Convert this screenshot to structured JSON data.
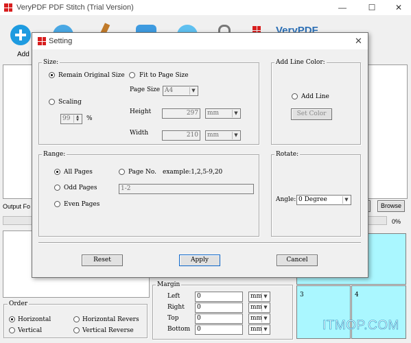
{
  "app": {
    "title": "VeryPDF PDF Stitch (Trial Version)"
  },
  "toolbar": {
    "add_label": "Add",
    "brand": "VeryPDF"
  },
  "main": {
    "output_label": "Output Fo",
    "browse_label": "Browse",
    "browse_partial": "e",
    "progress_text": "0%",
    "order": {
      "legend": "Order",
      "options": [
        "Horizontal",
        "Horizontal Revers",
        "Vertical",
        "Vertical Reverse"
      ],
      "selected": "Horizontal"
    },
    "margin": {
      "legend": "Margin",
      "rows": [
        {
          "label": "Left",
          "value": "0",
          "unit": "mm"
        },
        {
          "label": "Right",
          "value": "0",
          "unit": "mm"
        },
        {
          "label": "Top",
          "value": "0",
          "unit": "mm"
        },
        {
          "label": "Bottom",
          "value": "0",
          "unit": "mm"
        }
      ]
    },
    "preview_cells": [
      "3",
      "4"
    ]
  },
  "dialog": {
    "title": "Setting",
    "size": {
      "legend": "Size:",
      "remain_original": "Remain Original Size",
      "fit_to_page": "Fit to Page Size",
      "scaling": "Scaling",
      "scaling_value": "99",
      "percent": "%",
      "page_size_label": "Page Size",
      "page_size_value": "A4",
      "height_label": "Height",
      "height_value": "297",
      "height_unit": "mm",
      "width_label": "Width",
      "width_value": "210",
      "width_unit": "mm"
    },
    "line_color": {
      "legend": "Add Line Color:",
      "add_line": "Add Line",
      "set_color": "Set Color"
    },
    "range": {
      "legend": "Range:",
      "all_pages": "All Pages",
      "page_no": "Page No.",
      "page_no_example": "example:1,2,5-9,20",
      "odd_pages": "Odd Pages",
      "odd_value": "1-2",
      "even_pages": "Even Pages"
    },
    "rotate": {
      "legend": "Rotate:",
      "angle_label": "Angle:",
      "angle_value": "0 Degree"
    },
    "buttons": {
      "reset": "Reset",
      "apply": "Apply",
      "cancel": "Cancel"
    }
  },
  "watermark": "ITMOP.COM",
  "colors": {
    "accent_blue": "#1e9be0",
    "brand_red": "#d81e1e",
    "preview_cyan": "#aaf7ff"
  }
}
